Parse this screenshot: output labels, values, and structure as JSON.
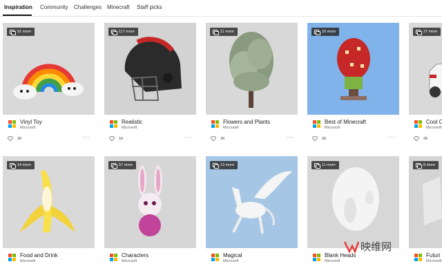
{
  "tabs": [
    {
      "label": "Inspiration",
      "active": true
    },
    {
      "label": "Community",
      "active": false
    },
    {
      "label": "Challenges",
      "active": false
    },
    {
      "label": "Minecraft",
      "active": false
    },
    {
      "label": "Staff picks",
      "active": false
    }
  ],
  "cards": [
    {
      "badge": "91 more",
      "title": "Vinyl Toy",
      "author": "Microsoft",
      "likes": "2K",
      "art": "rainbow"
    },
    {
      "badge": "117 more",
      "title": "Realistic",
      "author": "Microsoft",
      "likes": "1K",
      "art": "helmet"
    },
    {
      "badge": "11 more",
      "title": "Flowers and Plants",
      "author": "Microsoft",
      "likes": "2K",
      "art": "tree"
    },
    {
      "badge": "16 more",
      "title": "Best of Minecraft",
      "author": "Microsoft",
      "likes": "2K",
      "art": "minecraft"
    },
    {
      "badge": "27 more",
      "title": "Cool C",
      "author": "Microsoft",
      "likes": "2K",
      "art": "car"
    },
    {
      "badge": "14 more",
      "title": "Food and Drink",
      "author": "Microsoft",
      "likes": "",
      "art": "banana"
    },
    {
      "badge": "57 more",
      "title": "Characters",
      "author": "Microsoft",
      "likes": "",
      "art": "bunny"
    },
    {
      "badge": "13 more",
      "title": "Magical",
      "author": "Microsoft",
      "likes": "",
      "art": "pegasus"
    },
    {
      "badge": "11 more",
      "title": "Blank Heads",
      "author": "Microsoft",
      "likes": "",
      "art": "head"
    },
    {
      "badge": "8 more",
      "title": "Futuri",
      "author": "Microsoft",
      "likes": "",
      "art": "future"
    }
  ],
  "watermark": {
    "text": "映维网"
  },
  "colors": {
    "thumb_bg": "#dcdcdc",
    "minecraft_bg": "#7fb3ea",
    "magical_bg": "#a5c6e4"
  }
}
